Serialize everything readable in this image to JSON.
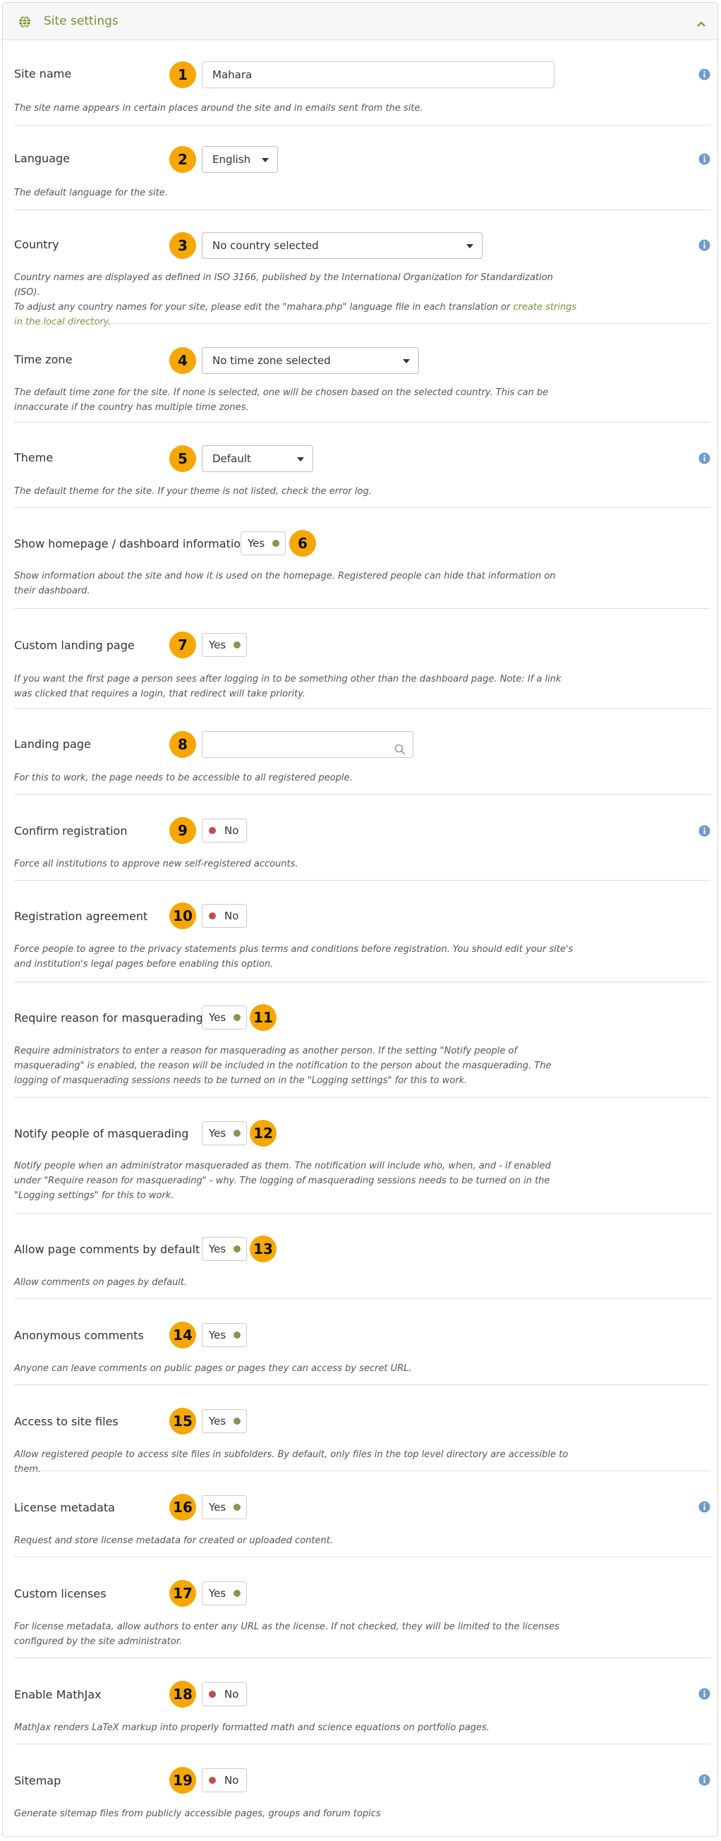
{
  "panel": {
    "title": "Site settings",
    "globe_icon": "globe-icon",
    "collapse_icon": "chevron-up-icon"
  },
  "colors": {
    "badge": "#f6a704",
    "header_title": "#6f9732",
    "link": "#6f9732",
    "info_icon": "#6d9ad0",
    "toggle_yes_dot": "#7d9a4e",
    "toggle_no_dot": "#c0504d"
  },
  "fields": {
    "site_name": {
      "label": "Site name",
      "badge": "1",
      "value": "Mahara",
      "desc": "The site name appears in certain places around the site and in emails sent from the site."
    },
    "language": {
      "label": "Language",
      "badge": "2",
      "selected": "English",
      "desc": "The default language for the site."
    },
    "country": {
      "label": "Country",
      "badge": "3",
      "selected": "No country selected",
      "desc_line1": "Country names are displayed as defined in ISO 3166, published by the International Organization for Standardization (ISO).",
      "desc_line2_prefix": "To adjust any country names for your site, please edit the \"mahara.php\" language file in each translation or ",
      "desc_link": "create strings in the local directory",
      "desc_suffix": "."
    },
    "time_zone": {
      "label": "Time zone",
      "badge": "4",
      "selected": "No time zone selected",
      "desc": "The default time zone for the site. If none is selected, one will be chosen based on the selected country. This can be innaccurate if the country has multiple time zones."
    },
    "theme": {
      "label": "Theme",
      "badge": "5",
      "selected": "Default",
      "desc": "The default theme for the site. If your theme is not listed, check the error log."
    },
    "show_homepage": {
      "label": "Show homepage / dashboard information",
      "badge": "6",
      "toggle": "Yes",
      "desc": "Show information about the site and how it is used on the homepage. Registered people can hide that information on their dashboard."
    },
    "custom_landing": {
      "label": "Custom landing page",
      "badge": "7",
      "toggle": "Yes",
      "desc": "If you want the first page a person sees after logging in to be something other than the dashboard page. Note: If a link was clicked that requires a login, that redirect will take priority."
    },
    "landing_page": {
      "label": "Landing page",
      "badge": "8",
      "value": "",
      "desc": "For this to work, the page needs to be accessible to all registered people."
    },
    "confirm_registration": {
      "label": "Confirm registration",
      "badge": "9",
      "toggle": "No",
      "desc": "Force all institutions to approve new self-registered accounts."
    },
    "registration_agreement": {
      "label": "Registration agreement",
      "badge": "10",
      "toggle": "No",
      "desc": "Force people to agree to the privacy statements plus terms and conditions before registration. You should edit your site's and institution's legal pages before enabling this option."
    },
    "require_reason": {
      "label": "Require reason for masquerading",
      "badge": "11",
      "toggle": "Yes",
      "desc": "Require administrators to enter a reason for masquerading as another person. If the setting \"Notify people of masquerading\" is enabled, the reason will be included in the notification to the person about the masquerading. The logging of masquerading sessions needs to be turned on in the \"Logging settings\" for this to work."
    },
    "notify_masquerading": {
      "label": "Notify people of masquerading",
      "badge": "12",
      "toggle": "Yes",
      "desc": "Notify people when an administrator masqueraded as them. The notification will include who, when, and - if enabled under \"Require reason for masquerading\" - why. The logging of masquerading sessions needs to be turned on in the \"Logging settings\" for this to work."
    },
    "page_comments": {
      "label": "Allow page comments by default",
      "badge": "13",
      "toggle": "Yes",
      "desc": "Allow comments on pages by default."
    },
    "anonymous_comments": {
      "label": "Anonymous comments",
      "badge": "14",
      "toggle": "Yes",
      "desc": "Anyone can leave comments on public pages or pages they can access by secret URL."
    },
    "site_files": {
      "label": "Access to site files",
      "badge": "15",
      "toggle": "Yes",
      "desc": "Allow registered people to access site files in subfolders. By default, only files in the top level directory are accessible to them."
    },
    "license_metadata": {
      "label": "License metadata",
      "badge": "16",
      "toggle": "Yes",
      "desc": "Request and store license metadata for created or uploaded content."
    },
    "custom_licenses": {
      "label": "Custom licenses",
      "badge": "17",
      "toggle": "Yes",
      "desc": "For license metadata, allow authors to enter any URL as the license. If not checked, they will be limited to the licenses configured by the site administrator."
    },
    "mathjax": {
      "label": "Enable MathJax",
      "badge": "18",
      "toggle": "No",
      "desc": "MathJax renders LaTeX markup into properly formatted math and science equations on portfolio pages."
    },
    "sitemap": {
      "label": "Sitemap",
      "badge": "19",
      "toggle": "No",
      "desc": "Generate sitemap files from publicly accessible pages, groups and forum topics"
    }
  }
}
